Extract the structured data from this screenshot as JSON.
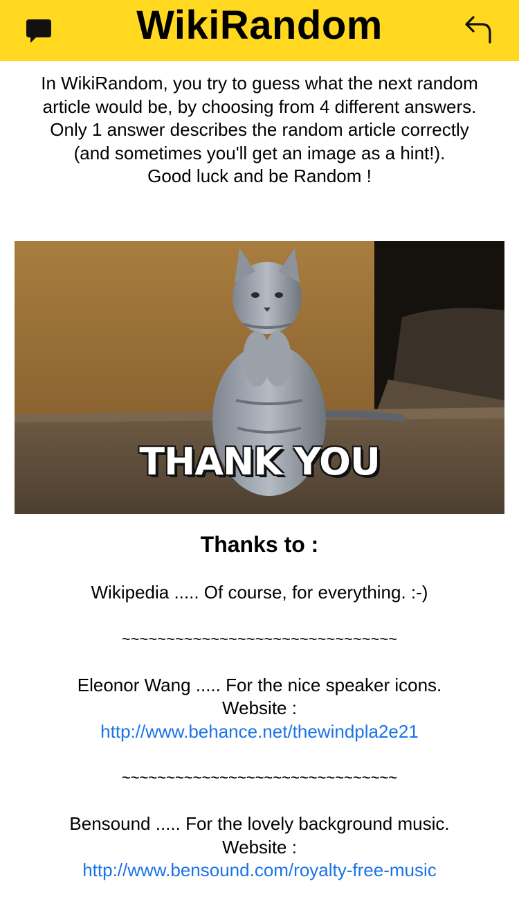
{
  "header": {
    "title": "WikiRandom",
    "chat_icon": "chat-bubble-icon",
    "back_icon": "back-arrow-icon",
    "background_color": "#ffd81f"
  },
  "intro": {
    "lines": [
      "In WikiRandom, you try to guess what the next random",
      "article would be, by choosing from 4 different answers.",
      "Only 1 answer describes the random article correctly",
      "(and sometimes you'll get an image as a hint!).",
      "Good luck and be Random !"
    ]
  },
  "gif": {
    "caption": "THANK YOU"
  },
  "thanks": {
    "heading": "Thanks to :",
    "wikipedia": "Wikipedia ..... Of course, for everything. :-)",
    "separator": "~~~~~~~~~~~~~~~~~~~~~~~~~~~~~~~",
    "eleonor": "Eleonor Wang ..... For the nice speaker icons.",
    "eleonor_website_label": "Website :",
    "eleonor_link": "http://www.behance.net/thewindpla2e21",
    "bensound": "Bensound ..... For the lovely background music.",
    "bensound_website_label": "Website :",
    "bensound_link": "http://www.bensound.com/royalty-free-music",
    "link_color": "#1a73e8"
  }
}
